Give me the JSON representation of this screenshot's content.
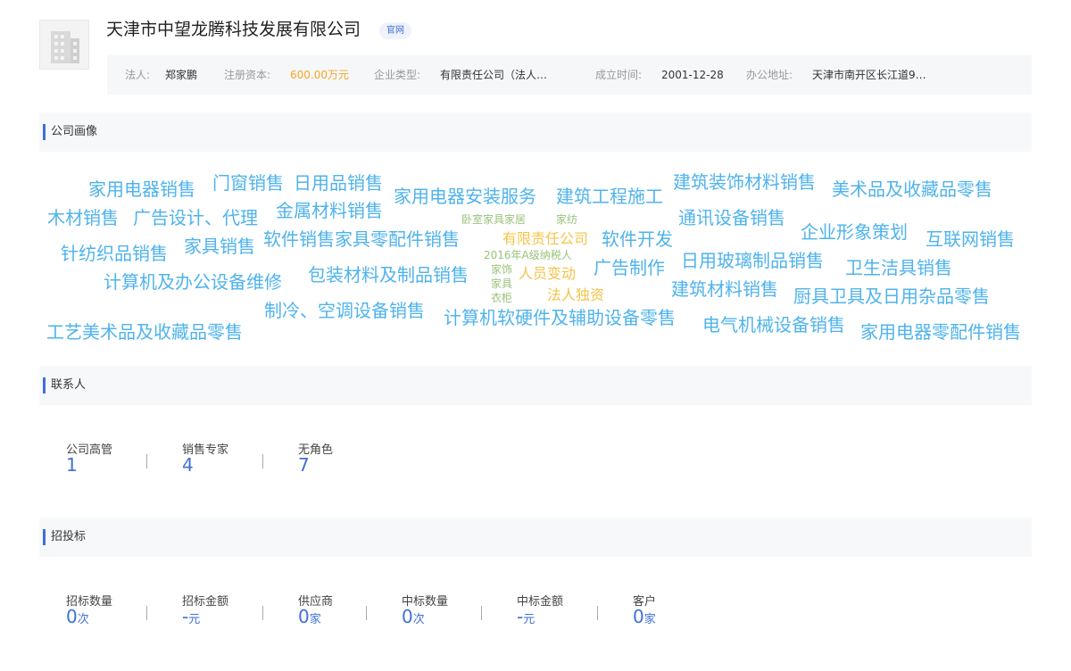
{
  "company": {
    "name": "天津市中望龙腾科技发展有限公司",
    "official_badge": "官网",
    "logo_icon": "building-icon"
  },
  "info": {
    "legal_person_label": "法人:",
    "legal_person_value": "郑家鹏",
    "capital_label": "注册资本:",
    "capital_value": "600.00万元",
    "type_label": "企业类型:",
    "type_value": "有限责任公司（法人…",
    "founded_label": "成立时间:",
    "founded_value": "2001-12-28",
    "address_label": "办公地址:",
    "address_value": "天津市南开区长江道9…"
  },
  "sections": {
    "portrait": "公司画像",
    "contacts": "联系人",
    "bidding": "招投标"
  },
  "tags": [
    "家用电器销售",
    "门窗销售",
    "日用品销售",
    "家用电器安装服务",
    "建筑工程施工",
    "建筑装饰材料销售",
    "美术品及收藏品零售",
    "木材销售",
    "广告设计、代理",
    "金属材料销售",
    "卧室家具家居",
    "家纺",
    "通讯设备销售",
    "企业形象策划",
    "互联网销售",
    "针纺织品销售",
    "家具销售",
    "软件销售",
    "家具零配件销售",
    "有限责任公司",
    "软件开发",
    "2016年A级纳税人",
    "计算机及办公设备维修",
    "包装材料及制品销售",
    "家饰",
    "人员变动",
    "广告制作",
    "日用玻璃制品销售",
    "卫生洁具销售",
    "家具",
    "衣柜",
    "法人独资",
    "建筑材料销售",
    "厨具卫具及日用杂品零售",
    "制冷、空调设备销售",
    "计算机软硬件及辅助设备零售",
    "电气机械设备销售",
    "家用电器零配件销售",
    "工艺美术品及收藏品零售"
  ],
  "tag_colors": {
    "primary": "#4fb3ec",
    "secondary": "#99c27a",
    "highlight": "#f4c44a"
  },
  "contacts": [
    {
      "label": "公司高管",
      "value": "1"
    },
    {
      "label": "销售专家",
      "value": "4"
    },
    {
      "label": "无角色",
      "value": "7"
    }
  ],
  "bidding": [
    {
      "label": "招标数量",
      "value": "0",
      "unit": "次"
    },
    {
      "label": "招标金额",
      "value": "-",
      "unit": "元"
    },
    {
      "label": "供应商",
      "value": "0",
      "unit": "家"
    },
    {
      "label": "中标数量",
      "value": "0",
      "unit": "次"
    },
    {
      "label": "中标金额",
      "value": "-",
      "unit": "元"
    },
    {
      "label": "客户",
      "value": "0",
      "unit": "家"
    }
  ],
  "accent_color": "#3f6fd8",
  "money_color": "#f5a623"
}
